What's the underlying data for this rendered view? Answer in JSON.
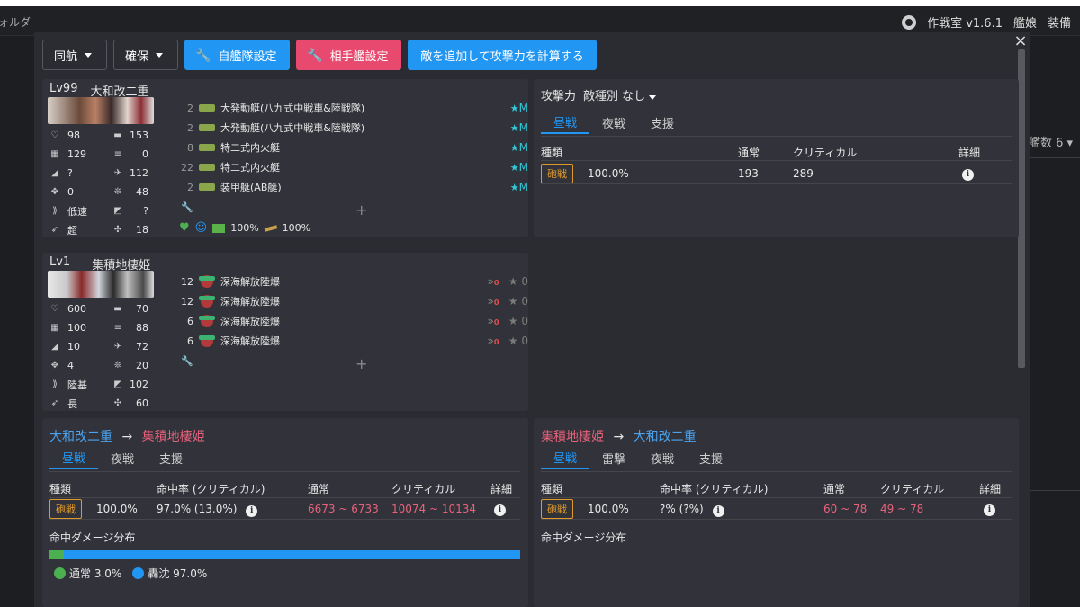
{
  "app": {
    "left_text": "ォルダ",
    "right_items": [
      "作戦室 v1.6.1",
      "艦娘",
      "装備"
    ],
    "right_panel_label": "艦数 6"
  },
  "toolbar": {
    "escort": "同航",
    "secure": "確保",
    "own_fleet": "自艦隊設定",
    "enemy_fleet": "相手艦設定",
    "add_enemy": "敵を追加して攻撃力を計算する"
  },
  "ship1": {
    "level": "Lv99",
    "name": "大和改二重",
    "stats": [
      {
        "icon": "hp-icon",
        "glyph": "♡",
        "value": "98"
      },
      {
        "icon": "firepower-icon",
        "glyph": "▬",
        "value": "153"
      },
      {
        "icon": "armor-icon",
        "glyph": "▦",
        "value": "129"
      },
      {
        "icon": "torpedo-icon",
        "glyph": "≡",
        "value": "0"
      },
      {
        "icon": "evasion-icon",
        "glyph": "◢",
        "value": "?"
      },
      {
        "icon": "aa-icon",
        "glyph": "✈",
        "value": "112"
      },
      {
        "icon": "aircraft-icon",
        "glyph": "✥",
        "value": "0"
      },
      {
        "icon": "asw-icon",
        "glyph": "❊",
        "value": "48"
      },
      {
        "icon": "speed-icon",
        "glyph": "⟫",
        "value": "低速"
      },
      {
        "icon": "los-icon",
        "glyph": "◩",
        "value": "?"
      },
      {
        "icon": "range-icon",
        "glyph": "➶",
        "value": "超"
      },
      {
        "icon": "luck-icon",
        "glyph": "✣",
        "value": "18"
      }
    ],
    "equipment": [
      {
        "count": "2",
        "name": "大発動艇(八九式中戦車&陸戦隊)",
        "star": "★",
        "prof": "M"
      },
      {
        "count": "2",
        "name": "大発動艇(八九式中戦車&陸戦隊)",
        "star": "★",
        "prof": "M"
      },
      {
        "count": "8",
        "name": "特二式内火艇",
        "star": "★",
        "prof": "M"
      },
      {
        "count": "22",
        "name": "特二式内火艇",
        "star": "★",
        "prof": "M"
      },
      {
        "count": "2",
        "name": "装甲艇(AB艇)",
        "star": "★",
        "prof": "M"
      }
    ],
    "ammo": "100%",
    "fuel": "100%"
  },
  "ship2": {
    "level": "Lv1",
    "name": "集積地棲姫",
    "stats": [
      {
        "icon": "hp-icon",
        "glyph": "♡",
        "value": "600"
      },
      {
        "icon": "firepower-icon",
        "glyph": "▬",
        "value": "70"
      },
      {
        "icon": "armor-icon",
        "glyph": "▦",
        "value": "100"
      },
      {
        "icon": "torpedo-icon",
        "glyph": "≡",
        "value": "88"
      },
      {
        "icon": "evasion-icon",
        "glyph": "◢",
        "value": "10"
      },
      {
        "icon": "aa-icon",
        "glyph": "✈",
        "value": "72"
      },
      {
        "icon": "aircraft-icon",
        "glyph": "✥",
        "value": "4"
      },
      {
        "icon": "asw-icon",
        "glyph": "❊",
        "value": "20"
      },
      {
        "icon": "speed-icon",
        "glyph": "⟫",
        "value": "陸基"
      },
      {
        "icon": "los-icon",
        "glyph": "◩",
        "value": "102"
      },
      {
        "icon": "range-icon",
        "glyph": "➶",
        "value": "長"
      },
      {
        "icon": "luck-icon",
        "glyph": "✣",
        "value": "60"
      }
    ],
    "equipment": [
      {
        "count": "12",
        "name": "深海解放陸爆",
        "prof_value": "0"
      },
      {
        "count": "12",
        "name": "深海解放陸爆",
        "prof_value": "0"
      },
      {
        "count": "6",
        "name": "深海解放陸爆",
        "prof_value": "0"
      },
      {
        "count": "6",
        "name": "深海解放陸爆",
        "prof_value": "0"
      }
    ],
    "chev_badge": "0"
  },
  "attack_panel": {
    "title": "攻撃力",
    "filter": "敵種別 なし",
    "tabs": [
      "昼戦",
      "夜戦",
      "支援"
    ],
    "headers": {
      "type": "種類",
      "normal": "通常",
      "critical": "クリティカル",
      "detail": "詳細"
    },
    "row": {
      "type": "砲戦",
      "rate": "100.0%",
      "normal": "193",
      "critical": "289"
    }
  },
  "damage_left": {
    "attacker": "大和改二重",
    "arrow": "→",
    "defender": "集積地棲姫",
    "tabs": [
      "昼戦",
      "夜戦",
      "支援"
    ],
    "headers": {
      "type": "種類",
      "hit": "命中率 (クリティカル)",
      "normal": "通常",
      "critical": "クリティカル",
      "detail": "詳細"
    },
    "row": {
      "type": "砲戦",
      "rate": "100.0%",
      "hit": "97.0% (13.0%)",
      "normal": "6673 ~ 6733",
      "critical": "10074 ~ 10134"
    },
    "dist_title": "命中ダメージ分布",
    "dist": {
      "normal_label": "通常 3.0%",
      "sunk_label": "轟沈 97.0%",
      "normal_fraction": 0.03,
      "sunk_fraction": 0.97
    }
  },
  "damage_right": {
    "attacker": "集積地棲姫",
    "arrow": "→",
    "defender": "大和改二重",
    "tabs": [
      "昼戦",
      "雷撃",
      "夜戦",
      "支援"
    ],
    "headers": {
      "type": "種類",
      "hit": "命中率 (クリティカル)",
      "normal": "通常",
      "critical": "クリティカル",
      "detail": "詳細"
    },
    "row": {
      "type": "砲戦",
      "rate": "100.0%",
      "hit": "?% (?%)",
      "normal": "60 ~ 78",
      "critical": "49 ~ 78"
    },
    "dist_title": "命中ダメージ分布"
  },
  "colors": {
    "accent_blue": "#2196f3",
    "accent_pink": "#e84a6f",
    "badge_orange": "#e09a2a",
    "damage_red": "#e8627c",
    "green": "#4caf50"
  }
}
